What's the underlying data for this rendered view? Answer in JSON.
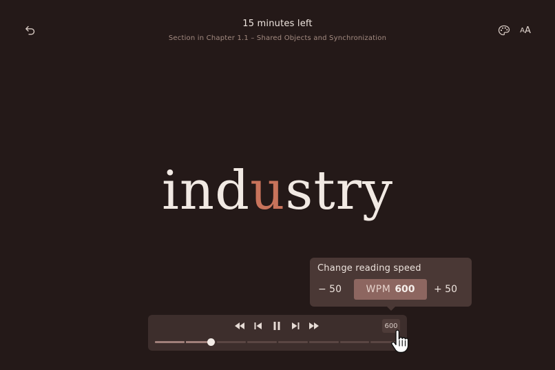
{
  "header": {
    "time_left": "15 minutes left",
    "section_title": "Section in Chapter 1.1 – Shared Objects and Synchronization"
  },
  "toolbar": {
    "back_icon": "undo-arrow-icon",
    "theme_icon": "palette-icon",
    "font_size_label_small": "A",
    "font_size_label_large": "A"
  },
  "reader": {
    "word_prefix": "ind",
    "word_focus": "u",
    "word_suffix": "stry"
  },
  "speed_popup": {
    "title": "Change reading speed",
    "decrease_label": "− 50",
    "wpm_label": "WPM",
    "wpm_value": "600",
    "increase_label": "+ 50"
  },
  "player": {
    "controls": [
      "rewind-icon",
      "step-back-icon",
      "pause-icon",
      "step-forward-icon",
      "fast-forward-icon"
    ],
    "speed_chip": "600",
    "progress_fraction": 0.23,
    "segments": 8
  },
  "colors": {
    "background": "#241918",
    "accent": "#c8735b",
    "popup": "#4a3835",
    "wpm_box": "#8d6660"
  }
}
